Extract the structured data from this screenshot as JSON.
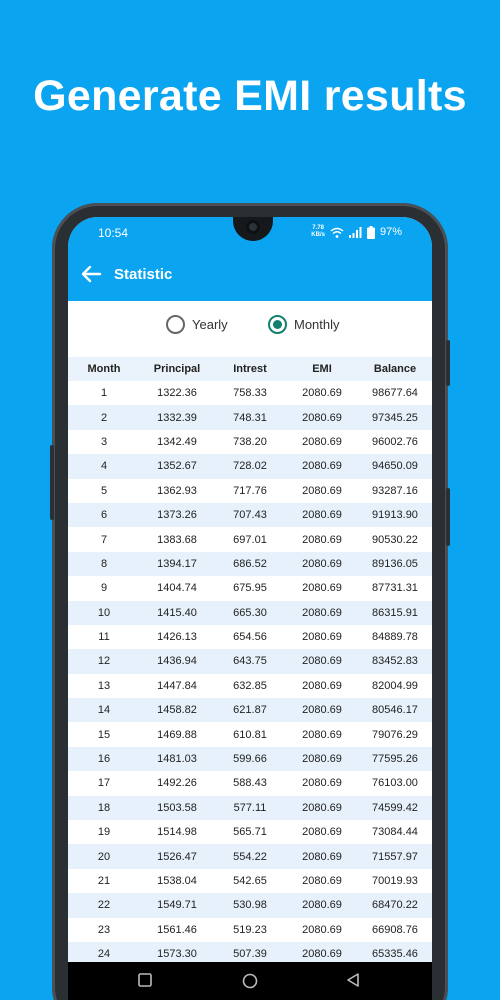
{
  "headline": "Generate EMI results",
  "status": {
    "time": "10:54",
    "netspeed_value": "7.78",
    "netspeed_unit": "KB/s",
    "battery": "97%"
  },
  "appbar": {
    "title": "Statistic"
  },
  "toggle": {
    "yearly_label": "Yearly",
    "monthly_label": "Monthly",
    "selected": "Monthly"
  },
  "table": {
    "headers": [
      "Month",
      "Principal",
      "Intrest",
      "EMI",
      "Balance"
    ],
    "rows": [
      [
        "1",
        "1322.36",
        "758.33",
        "2080.69",
        "98677.64"
      ],
      [
        "2",
        "1332.39",
        "748.31",
        "2080.69",
        "97345.25"
      ],
      [
        "3",
        "1342.49",
        "738.20",
        "2080.69",
        "96002.76"
      ],
      [
        "4",
        "1352.67",
        "728.02",
        "2080.69",
        "94650.09"
      ],
      [
        "5",
        "1362.93",
        "717.76",
        "2080.69",
        "93287.16"
      ],
      [
        "6",
        "1373.26",
        "707.43",
        "2080.69",
        "91913.90"
      ],
      [
        "7",
        "1383.68",
        "697.01",
        "2080.69",
        "90530.22"
      ],
      [
        "8",
        "1394.17",
        "686.52",
        "2080.69",
        "89136.05"
      ],
      [
        "9",
        "1404.74",
        "675.95",
        "2080.69",
        "87731.31"
      ],
      [
        "10",
        "1415.40",
        "665.30",
        "2080.69",
        "86315.91"
      ],
      [
        "11",
        "1426.13",
        "654.56",
        "2080.69",
        "84889.78"
      ],
      [
        "12",
        "1436.94",
        "643.75",
        "2080.69",
        "83452.83"
      ],
      [
        "13",
        "1447.84",
        "632.85",
        "2080.69",
        "82004.99"
      ],
      [
        "14",
        "1458.82",
        "621.87",
        "2080.69",
        "80546.17"
      ],
      [
        "15",
        "1469.88",
        "610.81",
        "2080.69",
        "79076.29"
      ],
      [
        "16",
        "1481.03",
        "599.66",
        "2080.69",
        "77595.26"
      ],
      [
        "17",
        "1492.26",
        "588.43",
        "2080.69",
        "76103.00"
      ],
      [
        "18",
        "1503.58",
        "577.11",
        "2080.69",
        "74599.42"
      ],
      [
        "19",
        "1514.98",
        "565.71",
        "2080.69",
        "73084.44"
      ],
      [
        "20",
        "1526.47",
        "554.22",
        "2080.69",
        "71557.97"
      ],
      [
        "21",
        "1538.04",
        "542.65",
        "2080.69",
        "70019.93"
      ],
      [
        "22",
        "1549.71",
        "530.98",
        "2080.69",
        "68470.22"
      ],
      [
        "23",
        "1561.46",
        "519.23",
        "2080.69",
        "66908.76"
      ],
      [
        "24",
        "1573.30",
        "507.39",
        "2080.69",
        "65335.46"
      ]
    ]
  },
  "colors": {
    "brand_blue": "#0aa4f0",
    "radio_selected": "#13806d",
    "row_stripe": "#e6f1fb"
  },
  "icons": {
    "back": "arrow-left-icon",
    "wifi": "wifi-icon",
    "signal": "signal-icon",
    "battery": "battery-icon",
    "nav_recents": "square-icon",
    "nav_home": "circle-icon",
    "nav_back": "triangle-back-icon"
  }
}
